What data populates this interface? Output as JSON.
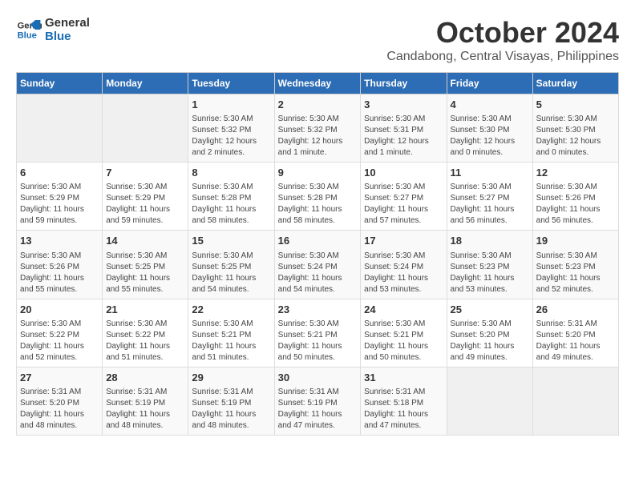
{
  "logo": {
    "line1": "General",
    "line2": "Blue"
  },
  "header": {
    "month_year": "October 2024",
    "location": "Candabong, Central Visayas, Philippines"
  },
  "days_of_week": [
    "Sunday",
    "Monday",
    "Tuesday",
    "Wednesday",
    "Thursday",
    "Friday",
    "Saturday"
  ],
  "weeks": [
    [
      {
        "day": "",
        "info": ""
      },
      {
        "day": "",
        "info": ""
      },
      {
        "day": "1",
        "info": "Sunrise: 5:30 AM\nSunset: 5:32 PM\nDaylight: 12 hours\nand 2 minutes."
      },
      {
        "day": "2",
        "info": "Sunrise: 5:30 AM\nSunset: 5:32 PM\nDaylight: 12 hours\nand 1 minute."
      },
      {
        "day": "3",
        "info": "Sunrise: 5:30 AM\nSunset: 5:31 PM\nDaylight: 12 hours\nand 1 minute."
      },
      {
        "day": "4",
        "info": "Sunrise: 5:30 AM\nSunset: 5:30 PM\nDaylight: 12 hours\nand 0 minutes."
      },
      {
        "day": "5",
        "info": "Sunrise: 5:30 AM\nSunset: 5:30 PM\nDaylight: 12 hours\nand 0 minutes."
      }
    ],
    [
      {
        "day": "6",
        "info": "Sunrise: 5:30 AM\nSunset: 5:29 PM\nDaylight: 11 hours\nand 59 minutes."
      },
      {
        "day": "7",
        "info": "Sunrise: 5:30 AM\nSunset: 5:29 PM\nDaylight: 11 hours\nand 59 minutes."
      },
      {
        "day": "8",
        "info": "Sunrise: 5:30 AM\nSunset: 5:28 PM\nDaylight: 11 hours\nand 58 minutes."
      },
      {
        "day": "9",
        "info": "Sunrise: 5:30 AM\nSunset: 5:28 PM\nDaylight: 11 hours\nand 58 minutes."
      },
      {
        "day": "10",
        "info": "Sunrise: 5:30 AM\nSunset: 5:27 PM\nDaylight: 11 hours\nand 57 minutes."
      },
      {
        "day": "11",
        "info": "Sunrise: 5:30 AM\nSunset: 5:27 PM\nDaylight: 11 hours\nand 56 minutes."
      },
      {
        "day": "12",
        "info": "Sunrise: 5:30 AM\nSunset: 5:26 PM\nDaylight: 11 hours\nand 56 minutes."
      }
    ],
    [
      {
        "day": "13",
        "info": "Sunrise: 5:30 AM\nSunset: 5:26 PM\nDaylight: 11 hours\nand 55 minutes."
      },
      {
        "day": "14",
        "info": "Sunrise: 5:30 AM\nSunset: 5:25 PM\nDaylight: 11 hours\nand 55 minutes."
      },
      {
        "day": "15",
        "info": "Sunrise: 5:30 AM\nSunset: 5:25 PM\nDaylight: 11 hours\nand 54 minutes."
      },
      {
        "day": "16",
        "info": "Sunrise: 5:30 AM\nSunset: 5:24 PM\nDaylight: 11 hours\nand 54 minutes."
      },
      {
        "day": "17",
        "info": "Sunrise: 5:30 AM\nSunset: 5:24 PM\nDaylight: 11 hours\nand 53 minutes."
      },
      {
        "day": "18",
        "info": "Sunrise: 5:30 AM\nSunset: 5:23 PM\nDaylight: 11 hours\nand 53 minutes."
      },
      {
        "day": "19",
        "info": "Sunrise: 5:30 AM\nSunset: 5:23 PM\nDaylight: 11 hours\nand 52 minutes."
      }
    ],
    [
      {
        "day": "20",
        "info": "Sunrise: 5:30 AM\nSunset: 5:22 PM\nDaylight: 11 hours\nand 52 minutes."
      },
      {
        "day": "21",
        "info": "Sunrise: 5:30 AM\nSunset: 5:22 PM\nDaylight: 11 hours\nand 51 minutes."
      },
      {
        "day": "22",
        "info": "Sunrise: 5:30 AM\nSunset: 5:21 PM\nDaylight: 11 hours\nand 51 minutes."
      },
      {
        "day": "23",
        "info": "Sunrise: 5:30 AM\nSunset: 5:21 PM\nDaylight: 11 hours\nand 50 minutes."
      },
      {
        "day": "24",
        "info": "Sunrise: 5:30 AM\nSunset: 5:21 PM\nDaylight: 11 hours\nand 50 minutes."
      },
      {
        "day": "25",
        "info": "Sunrise: 5:30 AM\nSunset: 5:20 PM\nDaylight: 11 hours\nand 49 minutes."
      },
      {
        "day": "26",
        "info": "Sunrise: 5:31 AM\nSunset: 5:20 PM\nDaylight: 11 hours\nand 49 minutes."
      }
    ],
    [
      {
        "day": "27",
        "info": "Sunrise: 5:31 AM\nSunset: 5:20 PM\nDaylight: 11 hours\nand 48 minutes."
      },
      {
        "day": "28",
        "info": "Sunrise: 5:31 AM\nSunset: 5:19 PM\nDaylight: 11 hours\nand 48 minutes."
      },
      {
        "day": "29",
        "info": "Sunrise: 5:31 AM\nSunset: 5:19 PM\nDaylight: 11 hours\nand 48 minutes."
      },
      {
        "day": "30",
        "info": "Sunrise: 5:31 AM\nSunset: 5:19 PM\nDaylight: 11 hours\nand 47 minutes."
      },
      {
        "day": "31",
        "info": "Sunrise: 5:31 AM\nSunset: 5:18 PM\nDaylight: 11 hours\nand 47 minutes."
      },
      {
        "day": "",
        "info": ""
      },
      {
        "day": "",
        "info": ""
      }
    ]
  ]
}
